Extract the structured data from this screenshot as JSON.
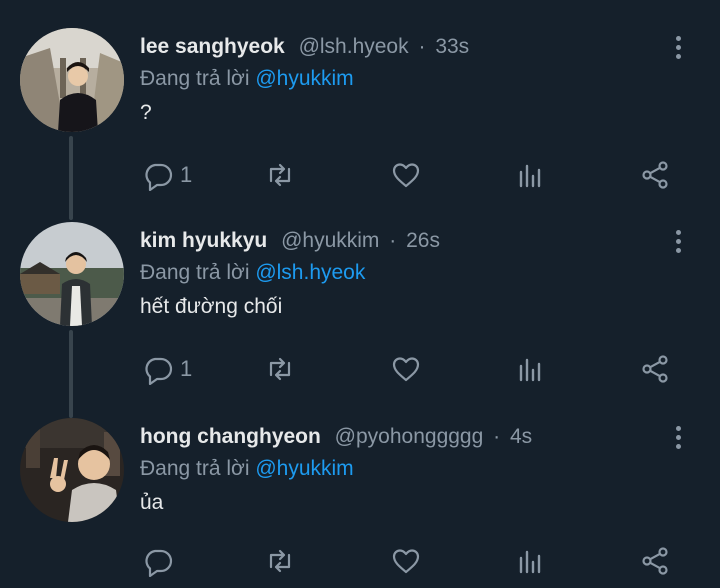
{
  "tweets": [
    {
      "name": "lee sanghyeok",
      "handle": "@lsh.hyeok",
      "separator": "·",
      "time": "33s",
      "reply_prefix": "Đang trả lời",
      "reply_to": "@hyukkim",
      "text": "?",
      "reply_count": "1",
      "avatar_icon": "person-photo-avatar"
    },
    {
      "name": "kim hyukkyu",
      "handle": "@hyukkim",
      "separator": "·",
      "time": "26s",
      "reply_prefix": "Đang trả lời",
      "reply_to": "@lsh.hyeok",
      "text": "hết đường chối",
      "reply_count": "1",
      "avatar_icon": "person-photo-avatar"
    },
    {
      "name": "hong changhyeon",
      "handle": "@pyohonggggg",
      "separator": "·",
      "time": "4s",
      "reply_prefix": "Đang trả lời",
      "reply_to": "@hyukkim",
      "text": "ủa",
      "reply_count": "",
      "avatar_icon": "person-photo-avatar"
    }
  ],
  "icons": [
    "more-icon",
    "reply-icon",
    "retweet-icon",
    "like-icon",
    "views-icon",
    "share-icon"
  ],
  "colors": {
    "background": "#15202b",
    "primary_text": "#e7e9ea",
    "secondary_text": "#8b98a5",
    "mention": "#1d9bf0",
    "thread_line": "#38444d"
  }
}
